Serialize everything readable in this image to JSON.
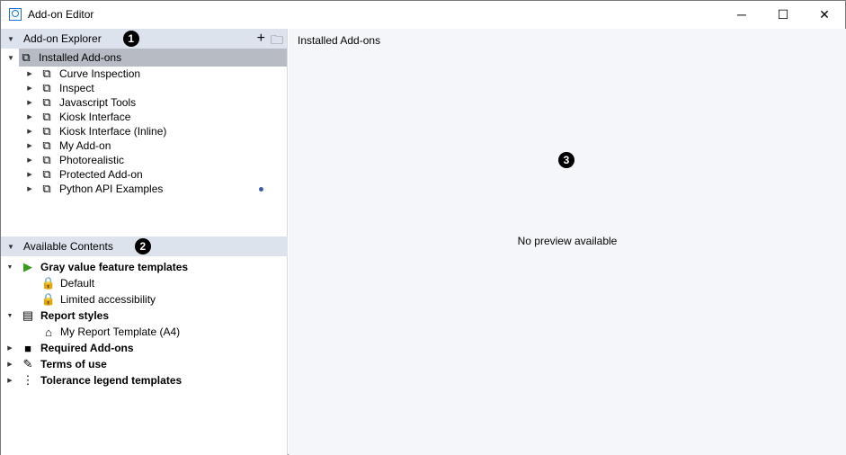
{
  "window": {
    "title": "Add-on Editor",
    "minimize": "─",
    "maximize": "☐",
    "close": "✕"
  },
  "explorer": {
    "header": "Add-on Explorer",
    "badge": "1",
    "add": "+",
    "folder": "🗀",
    "root": "Installed Add-ons",
    "items": [
      {
        "label": "Curve Inspection"
      },
      {
        "label": "Inspect"
      },
      {
        "label": "Javascript Tools"
      },
      {
        "label": "Kiosk Interface"
      },
      {
        "label": "Kiosk Interface (Inline)"
      },
      {
        "label": "My Add-on"
      },
      {
        "label": "Photorealistic"
      },
      {
        "label": "Protected Add-on"
      },
      {
        "label": "Python API Examples",
        "modified": true
      }
    ]
  },
  "contents": {
    "header": "Available Contents",
    "badge": "2",
    "groups": [
      {
        "label": "Gray value feature templates",
        "icon": "green-template-icon",
        "expanded": true,
        "children": [
          {
            "label": "Default",
            "icon": "lock-icon"
          },
          {
            "label": "Limited accessibility",
            "icon": "lock-icon"
          }
        ]
      },
      {
        "label": "Report styles",
        "icon": "report-icon",
        "expanded": true,
        "children": [
          {
            "label": "My Report Template (A4)",
            "icon": "easel-icon"
          }
        ]
      },
      {
        "label": "Required Add-ons",
        "icon": "box-icon",
        "expanded": false
      },
      {
        "label": "Terms of use",
        "icon": "document-edit-icon",
        "expanded": false
      },
      {
        "label": "Tolerance legend templates",
        "icon": "legend-icon",
        "expanded": false
      }
    ]
  },
  "preview": {
    "title": "Installed Add-ons",
    "badge": "3",
    "empty": "No preview available"
  },
  "colors": {
    "header_bg": "#dde3ec",
    "selection": "#b7bcc4",
    "preview_bg": "#f5f6fa",
    "modified_dot": "#3b5ca8"
  }
}
